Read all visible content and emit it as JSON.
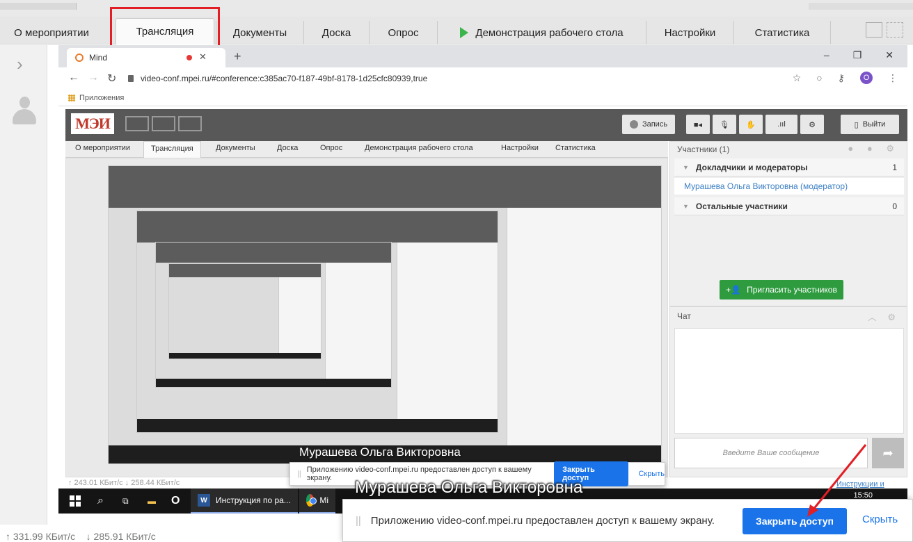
{
  "tabs": {
    "items": [
      {
        "label": "О мероприятии"
      },
      {
        "label": "Трансляция"
      },
      {
        "label": "Документы"
      },
      {
        "label": "Доска"
      },
      {
        "label": "Опрос"
      },
      {
        "label": "Демонстрация рабочего стола"
      },
      {
        "label": "Настройки"
      },
      {
        "label": "Статистика"
      }
    ],
    "active_index": 1
  },
  "browser": {
    "tab_title": "Mind",
    "url": "video-conf.mpei.ru/#conference:c385ac70-f187-49bf-8178-1d25cfc80939,true",
    "bookmarks_label": "Приложения",
    "profile_letter": "O"
  },
  "inner": {
    "logo_text": "МЭИ",
    "record_label": "Запись",
    "exit_label": "Выйти",
    "tabs": [
      "О мероприятии",
      "Трансляция",
      "Документы",
      "Доска",
      "Опрос",
      "Демонстрация рабочего стола",
      "Настройки",
      "Статистика"
    ]
  },
  "participants": {
    "title": "Участники (1)",
    "speakers_group": "Докладчики и модераторы",
    "speakers_count": "1",
    "moderator_name": "Мурашева Ольга Викторовна (модератор)",
    "others_group": "Остальные участники",
    "others_count": "0",
    "invite_label": "Пригласить участников"
  },
  "chat": {
    "title": "Чат",
    "input_placeholder": "Введите Ваше сообщение",
    "help_link": "Инструкции и поддержка"
  },
  "inner_stats": "↑ 243.01 КБит/с  ↓ 258.44 КБит/с",
  "presenter_name": "Мурашева Ольга Викторовна",
  "share_notice": {
    "text": "Приложению video-conf.mpei.ru предоставлен доступ к вашему экрану.",
    "close_label": "Закрыть доступ",
    "hide_label": "Скрыть"
  },
  "taskbar": {
    "word_app": "Инструкция по ра...",
    "chrome_app": "Mi",
    "time": "15:50"
  },
  "status": {
    "upload": "↑ 331.99 КБит/с",
    "download": "↓ 285.91 КБит/с"
  },
  "colors": {
    "highlight": "#e31e24",
    "accent_blue": "#1a73e8",
    "green": "#2e9b3f",
    "arrow": "#e31e24"
  }
}
